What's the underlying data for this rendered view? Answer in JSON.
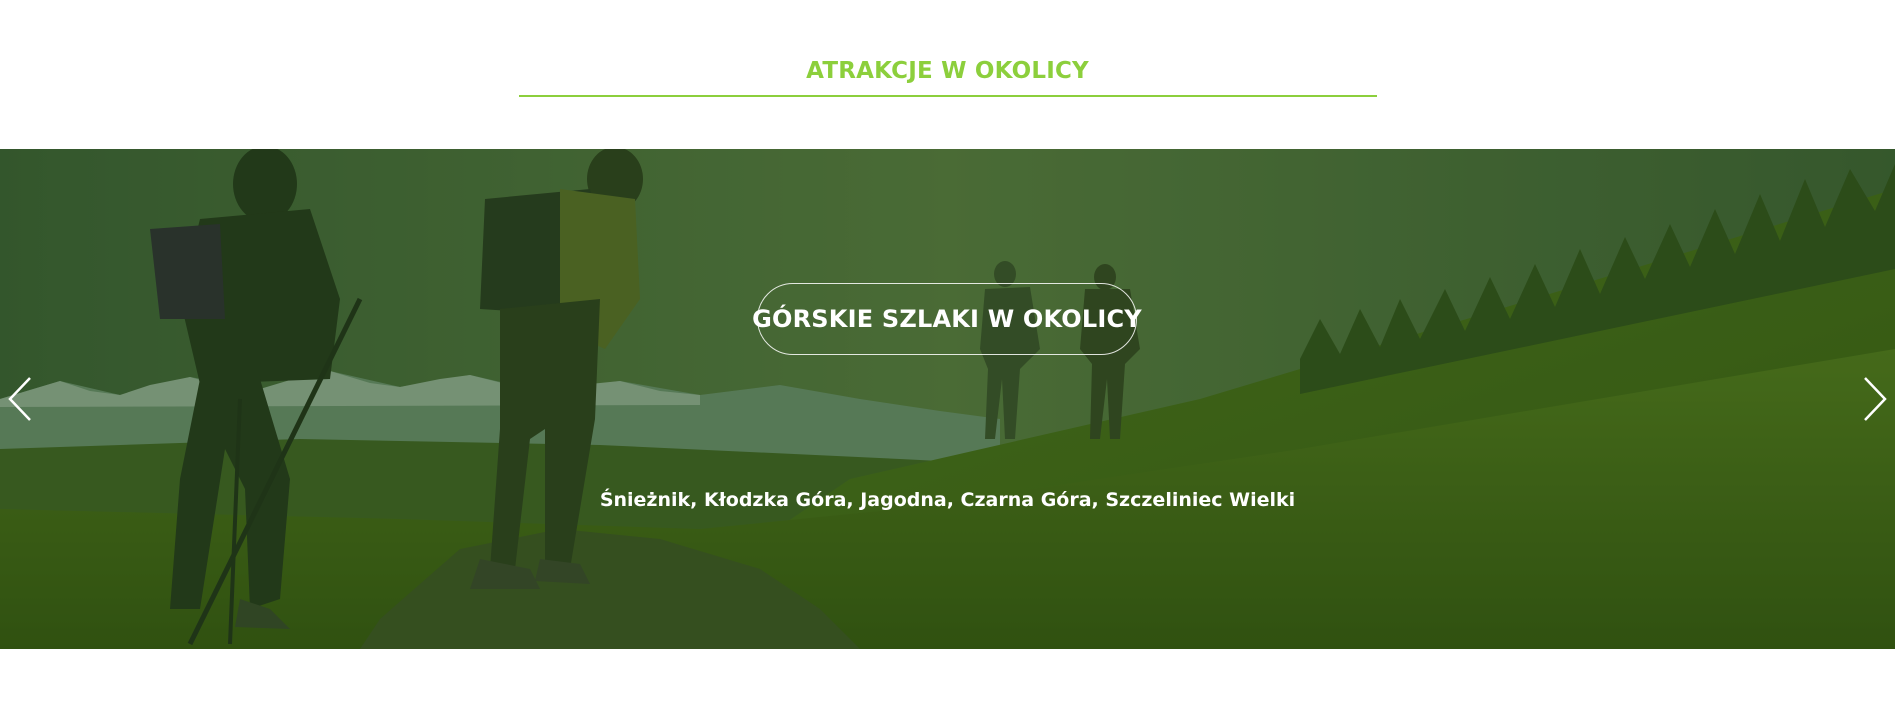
{
  "section": {
    "title": "ATRAKCJE W OKOLICY"
  },
  "slider": {
    "slide_title": "GÓRSKIE SZLAKI W OKOLICY",
    "slide_subtitle": "Śnieżnik, Kłodzka Góra, Jagodna, Czarna Góra, Szczeliniec Wielki",
    "prev_icon": "chevron-left-icon",
    "next_icon": "chevron-right-icon"
  },
  "colors": {
    "accent": "#8ccf3c",
    "overlay": "#2f5a1c",
    "text_on_image": "#ffffff"
  }
}
